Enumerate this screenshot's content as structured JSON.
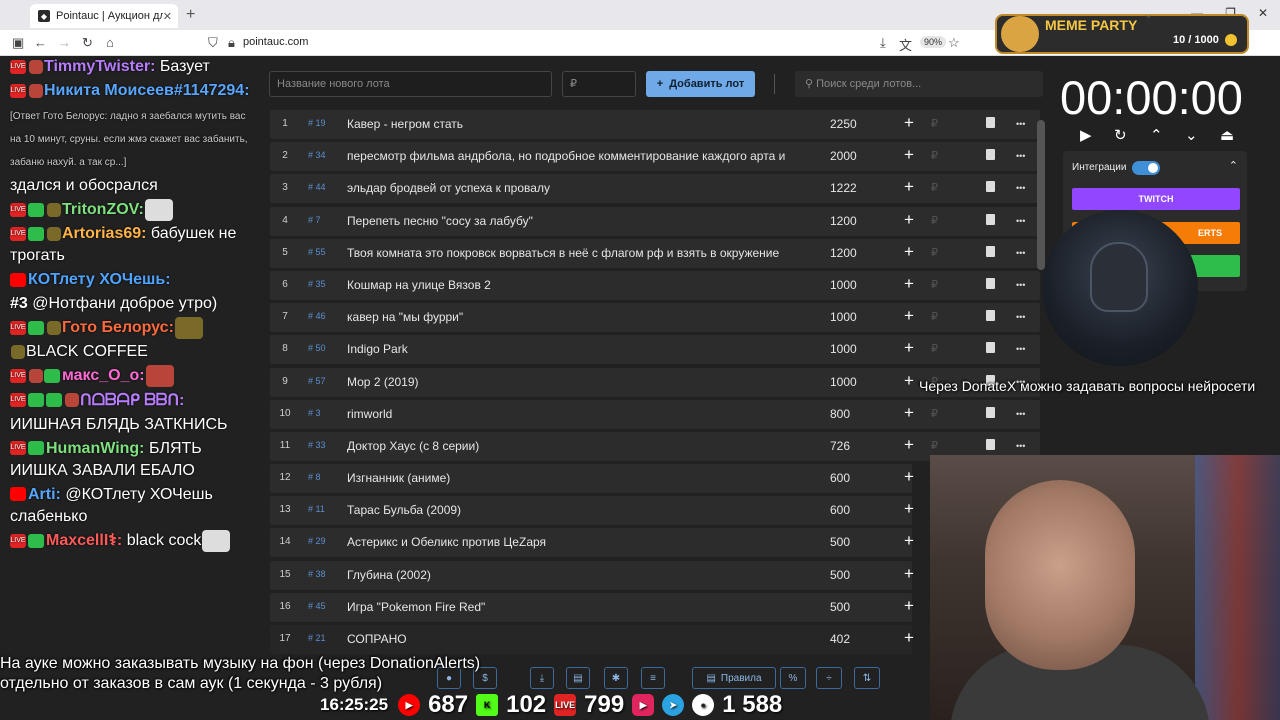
{
  "browser": {
    "tab_title": "Pointauc | Аукцион для стримера",
    "url": "pointauc.com",
    "zoom": "90%"
  },
  "toolbar": {
    "new_lot_placeholder": "Название нового лота",
    "currency_placeholder": "₽",
    "add_lot_label": "Добавить лот",
    "search_placeholder": "Поиск среди лотов..."
  },
  "lots": [
    {
      "num": "1",
      "id": "19",
      "name": "Кавер - негром стать",
      "amount": "2250"
    },
    {
      "num": "2",
      "id": "34",
      "name": "пересмотр фильма андрбола, но подробное комментирование каждого арта и",
      "amount": "2000"
    },
    {
      "num": "3",
      "id": "44",
      "name": "эльдар бродвей от успеха к провалу",
      "amount": "1222"
    },
    {
      "num": "4",
      "id": "7",
      "name": "Перепеть песню \"сосу за лабубу\"",
      "amount": "1200"
    },
    {
      "num": "5",
      "id": "55",
      "name": "Твоя комната это покровск ворваться в неё с флагом рф и взять в окружение",
      "amount": "1200"
    },
    {
      "num": "6",
      "id": "35",
      "name": "Кошмар на улице Вязов 2",
      "amount": "1000"
    },
    {
      "num": "7",
      "id": "46",
      "name": "кавер на \"мы фурри\"",
      "amount": "1000"
    },
    {
      "num": "8",
      "id": "50",
      "name": "Indigo Park",
      "amount": "1000"
    },
    {
      "num": "9",
      "id": "57",
      "name": "Мор 2 (2019)",
      "amount": "1000"
    },
    {
      "num": "10",
      "id": "3",
      "name": "rimworld",
      "amount": "800"
    },
    {
      "num": "11",
      "id": "33",
      "name": "Доктор Хаус (с 8 серии)",
      "amount": "726"
    },
    {
      "num": "12",
      "id": "8",
      "name": "Изгнанник (аниме)",
      "amount": "600"
    },
    {
      "num": "13",
      "id": "11",
      "name": "Тарас Бульба (2009)",
      "amount": "600"
    },
    {
      "num": "14",
      "id": "29",
      "name": "Астерикс и Обеликс против ЦеZаря",
      "amount": "500"
    },
    {
      "num": "15",
      "id": "38",
      "name": "Глубина (2002)",
      "amount": "500"
    },
    {
      "num": "16",
      "id": "45",
      "name": "Игра \"Pokemon Fire Red\"",
      "amount": "500"
    },
    {
      "num": "17",
      "id": "21",
      "name": "СОПРАНО",
      "amount": "402"
    }
  ],
  "rub_symbol": "₽",
  "bottom": {
    "rules_label": "Правила",
    "percent_label": "%"
  },
  "timer": {
    "display": "00:00:00"
  },
  "integrations": {
    "label": "Интеграции",
    "twitch_label": "TWITCH",
    "da_label": "ERTS"
  },
  "meme": {
    "title": "MEME PARTY",
    "count": "10 / 1000"
  },
  "chat": [
    {
      "nick": "TimmyTwister:",
      "text": " Базует"
    },
    {
      "nick": "Никита Моисеев#1147294:",
      "text": ""
    },
    {
      "reply": "[Ответ Гото Белорус: ладно я заебался мутить вас на 10 минут, сруны. если жмэ скажет вас забанить, забаню нахуй. а так ср...]"
    },
    {
      "nick": "",
      "text": "здался и обосрался"
    },
    {
      "nick": "TritonZOV:",
      "text": ""
    },
    {
      "nick": "Artorias69:",
      "text": " бабушек не трогать"
    },
    {
      "nick": "КОТлету ХОЧешь:",
      "text": ""
    },
    {
      "nick": "#3",
      "text": " @Нотфани доброе утро)"
    },
    {
      "nick": "Гото Белорус:",
      "text": ""
    },
    {
      "nick": "",
      "text": "BLACK COFFEE"
    },
    {
      "nick": "макс_О_о:",
      "text": ""
    },
    {
      "nick": "ᑎᗝᗷᗩᑭ ᗷᗷᑎ:",
      "text": ""
    },
    {
      "nick": "",
      "text": "ИИШНАЯ БЛЯДЬ ЗАТКНИСЬ"
    },
    {
      "nick": "HumanWing:",
      "text": " БЛЯТЬ ИИШКА ЗАВАЛИ ЕБАЛО"
    },
    {
      "nick": "Arti:",
      "text": " @КОТлету ХОЧешь слабенько"
    },
    {
      "nick": "MaxcellI⚕:",
      "text": " black cock"
    }
  ],
  "subtitle": {
    "line1": "На ауке можно заказывать музыку на фон (через DonationAlerts)",
    "line2": "отдельно от заказов в сам аук (1 секунда - 3 рубля)"
  },
  "ai_note": "Через DonateX можно задавать вопросы нейросети",
  "stats": {
    "clock": "16:25:25",
    "youtube": "687",
    "kick": "102",
    "vklive": "799",
    "rutube": "",
    "telegram": "",
    "total": "1 588"
  },
  "colors": {
    "accent": "#6fa9e7",
    "twitch": "#9146ff",
    "donationalerts": "#f57d07",
    "green": "#2ebd4b"
  }
}
